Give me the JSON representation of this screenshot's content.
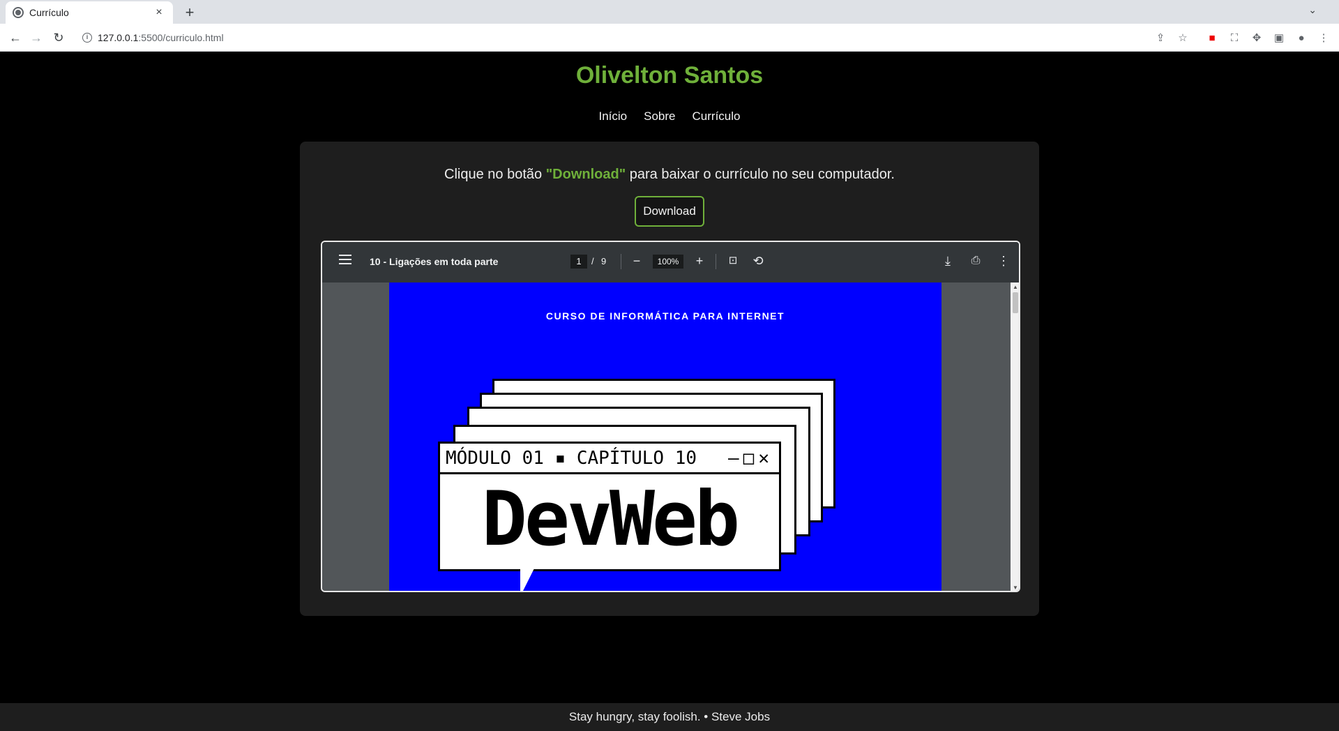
{
  "browser": {
    "tab_title": "Currículo",
    "tab_close": "×",
    "new_tab": "+",
    "url_host": "127.0.0.1",
    "url_rest": ":5500/curriculo.html"
  },
  "site": {
    "title": "Olivelton Santos",
    "nav": [
      "Início",
      "Sobre",
      "Currículo"
    ]
  },
  "content": {
    "message_before": "Clique no botão ",
    "message_highlight": "\"Download\"",
    "message_after": " para baixar o currículo no seu computador.",
    "download_label": "Download"
  },
  "pdf_viewer": {
    "doc_title": "10 - Ligações em toda parte",
    "current_page": "1",
    "page_separator": "/",
    "total_pages": "9",
    "zoom": "100%",
    "page_content": {
      "course_heading": "CURSO DE INFORMÁTICA PARA INTERNET",
      "window_caption": "MÓDULO 01 ▪ CAPÍTULO 10",
      "window_controls": "—□✕",
      "big_text": "DevWeb"
    }
  },
  "footer": {
    "quote": "Stay hungry, stay foolish. • Steve Jobs"
  },
  "colors": {
    "accent": "#6fb03a",
    "pdf_blue": "#0000ff"
  }
}
